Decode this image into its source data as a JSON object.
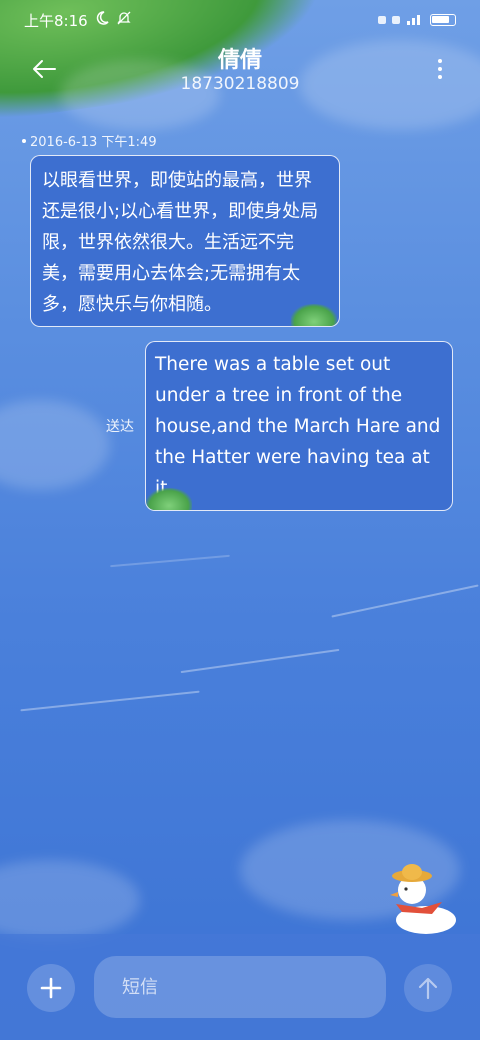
{
  "status_bar": {
    "time": "上午8:16",
    "moon_icon": "moon-icon",
    "mute_icon": "mute-icon"
  },
  "header": {
    "contact_name": "倩倩",
    "phone_number": "18730218809",
    "back_icon": "arrow-left-icon",
    "more_icon": "more-vertical-icon"
  },
  "conversation": {
    "timestamp": "2016-6-13 下午1:49",
    "messages": [
      {
        "direction": "incoming",
        "text": "以眼看世界，即使站的最高，世界还是很小;以心看世界，即使身处局限，世界依然很大。生活远不完美，需要用心去体会;无需拥有太多，愿快乐与你相随。"
      },
      {
        "direction": "outgoing",
        "text": "There was a table set out under a tree in front of the house,and the March Hare and the Hatter were having tea at it.",
        "status": "送达"
      }
    ]
  },
  "composer": {
    "placeholder": "短信",
    "add_icon": "plus-icon",
    "send_icon": "arrow-up-icon"
  },
  "colors": {
    "background": "#4a80db",
    "bubble": "#3d6fd0",
    "input_bar": "#4678d7"
  }
}
